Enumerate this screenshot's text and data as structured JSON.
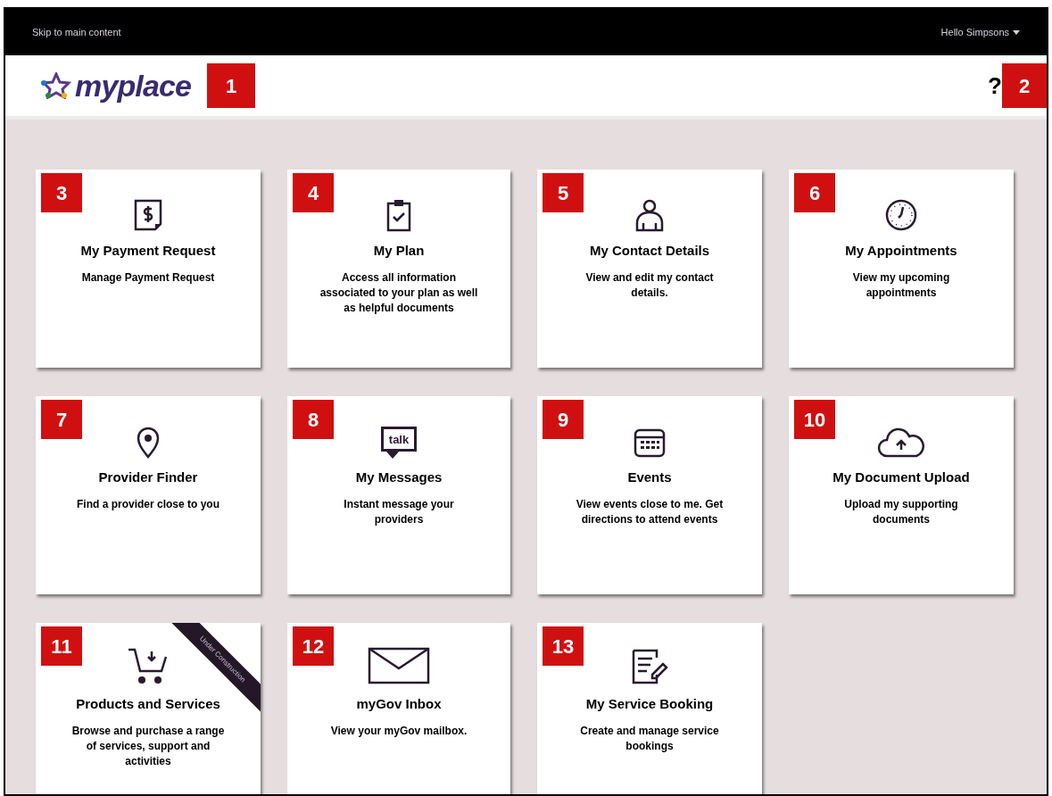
{
  "top_bar": {
    "skip_link": "Skip to main content",
    "user_menu": "Hello Simpsons"
  },
  "header": {
    "logo": "myplace",
    "logo_badge": "1",
    "help": "?",
    "help_badge": "2"
  },
  "tiles": [
    {
      "badge": "3",
      "kind": "payment",
      "title": "My Payment Request",
      "description": "Manage Payment Request"
    },
    {
      "badge": "4",
      "kind": "plan",
      "title": "My Plan",
      "description": "Access all information associated to your plan as well as helpful documents"
    },
    {
      "badge": "5",
      "kind": "person",
      "title": "My Contact Details",
      "description": "View and edit my contact details."
    },
    {
      "badge": "6",
      "kind": "clock",
      "title": "My Appointments",
      "description": "View my upcoming appointments"
    },
    {
      "badge": "7",
      "kind": "pin",
      "title": "Provider Finder",
      "description": "Find a provider close to you"
    },
    {
      "badge": "8",
      "kind": "talk",
      "icon_text": "talk",
      "title": "My Messages",
      "description": "Instant message your providers"
    },
    {
      "badge": "9",
      "kind": "calendar",
      "title": "Events",
      "description": "View events close to me. Get directions to attend events"
    },
    {
      "badge": "10",
      "kind": "cloud",
      "title": "My Document Upload",
      "description": "Upload my supporting documents"
    },
    {
      "badge": "11",
      "kind": "cart",
      "title": "Products and Services",
      "description": "Browse and purchase a range of services, support and activities",
      "ribbon": "Under Construction"
    },
    {
      "badge": "12",
      "kind": "mail",
      "title": "myGov Inbox",
      "description": "View your myGov mailbox."
    },
    {
      "badge": "13",
      "kind": "form",
      "title": "My Service Booking",
      "description": "Create and manage service bookings"
    }
  ]
}
